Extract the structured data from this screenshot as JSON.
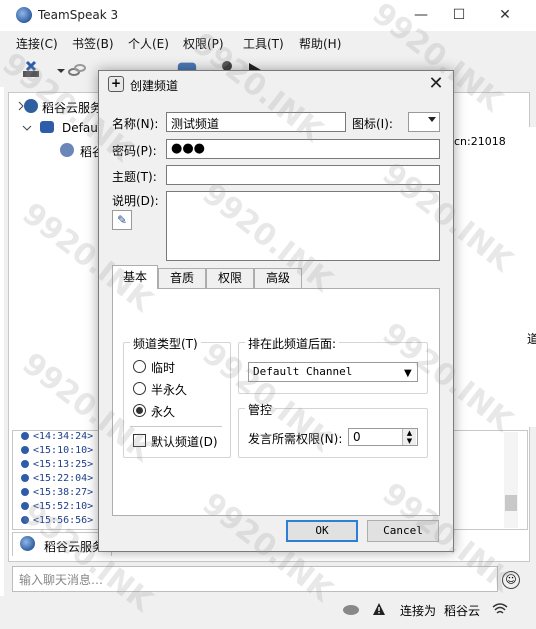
{
  "window": {
    "title": "TeamSpeak 3",
    "minimize": "—",
    "maximize": "☐",
    "close": "✕"
  },
  "menu": [
    "连接(C)",
    "书签(B)",
    "个人(E)",
    "权限(P)",
    "工具(T)",
    "帮助(H)"
  ],
  "tree": {
    "root": "稻谷云服务",
    "channel": "Default",
    "user": "稻谷"
  },
  "info": {
    "host": "cn:21018",
    "right_char": "道"
  },
  "chat_log": [
    "<14:34:24>",
    "<15:10:10>",
    "<15:13:25>",
    "<15:22:04>",
    "<15:38:27>",
    "<15:52:10>",
    "<15:56:56>"
  ],
  "server_tab": {
    "label": "稻谷云服务"
  },
  "chat_input": {
    "placeholder": "输入聊天消息…"
  },
  "status": {
    "connected_text": "连接为",
    "server": "稻谷云"
  },
  "dialog": {
    "title": "创建频道",
    "close": "✕",
    "name_label": "名称(N):",
    "name_value": "测试频道",
    "icon_label": "图标(I):",
    "password_label": "密码(P):",
    "password_value": "●●●",
    "topic_label": "主题(T):",
    "topic_value": "",
    "description_label": "说明(D):",
    "tabs": [
      "基本",
      "音质",
      "权限",
      "高级"
    ],
    "channel_type": {
      "title": "频道类型(T)",
      "options": [
        "临时",
        "半永久",
        "永久"
      ],
      "selected": "永久",
      "default_label": "默认频道(D)"
    },
    "sort_after": {
      "title": "排在此频道后面:",
      "value": "Default Channel"
    },
    "moderation": {
      "title": "管控",
      "talk_power_label": "发言所需权限(N):",
      "talk_power_value": "0"
    },
    "ok": "OK",
    "cancel": "Cancel"
  },
  "watermark": "9920.INK"
}
